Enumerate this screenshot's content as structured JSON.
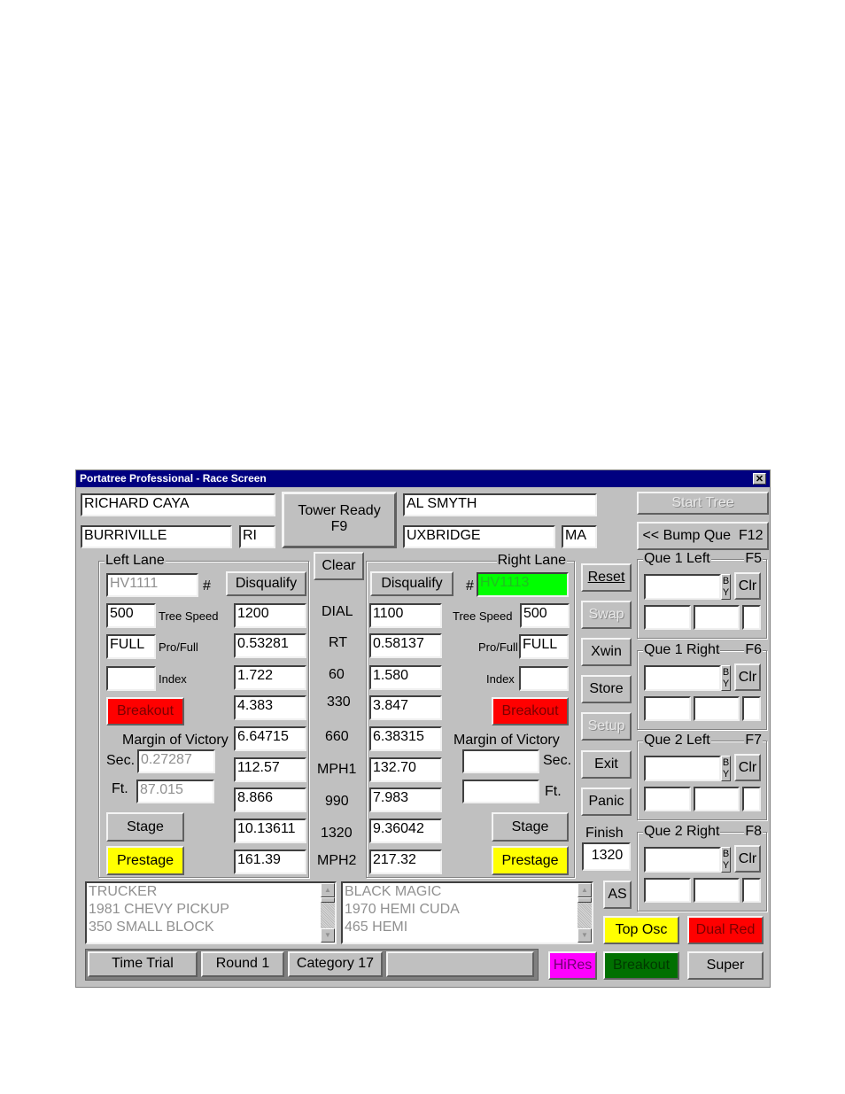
{
  "window": {
    "title": "Portatree Professional - Race Screen",
    "close_glyph": "✕"
  },
  "left": {
    "name": "RICHARD CAYA",
    "city": "BURRIVILLE",
    "state": "RI",
    "lane_label": "Left Lane",
    "car_number": "HV1111",
    "hash": "#",
    "disqualify": "Disqualify",
    "tree_speed_label": "Tree Speed",
    "tree_speed": "500",
    "pro_full_label": "Pro/Full",
    "pro_full": "FULL",
    "index_label": "Index",
    "index": "",
    "breakout": "Breakout",
    "margin_label": "Margin of Victory",
    "sec_label": "Sec.",
    "sec": "0.27287",
    "ft_label": "Ft.",
    "ft": "87.015",
    "stage": "Stage",
    "prestage": "Prestage",
    "times": {
      "dial": "1200",
      "rt": "0.53281",
      "t60": "1.722",
      "t330": "4.383",
      "t660": "6.64715",
      "mph1": "112.57",
      "t990": "8.866",
      "t1320": "10.13611",
      "mph2": "161.39"
    },
    "car_info": [
      "TRUCKER",
      "1981 CHEVY PICKUP",
      "350 SMALL BLOCK"
    ]
  },
  "right": {
    "name": "AL SMYTH",
    "city": "UXBRIDGE",
    "state": "MA",
    "lane_label": "Right Lane",
    "car_number": "HV1113",
    "hash": "#",
    "disqualify": "Disqualify",
    "tree_speed_label": "Tree Speed",
    "tree_speed": "500",
    "pro_full_label": "Pro/Full",
    "pro_full": "FULL",
    "index_label": "Index",
    "index": "",
    "breakout": "Breakout",
    "margin_label": "Margin of Victory",
    "sec_label": "Sec.",
    "sec": "",
    "ft_label": "Ft.",
    "ft": "",
    "stage": "Stage",
    "prestage": "Prestage",
    "times": {
      "dial": "1100",
      "rt": "0.58137",
      "t60": "1.580",
      "t330": "3.847",
      "t660": "6.38315",
      "mph1": "132.70",
      "t990": "7.983",
      "t1320": "9.36042",
      "mph2": "217.32"
    },
    "car_info": [
      "BLACK MAGIC",
      "1970 HEMI CUDA",
      "465 HEMI"
    ]
  },
  "center": {
    "tower_ready_line1": "Tower Ready",
    "tower_ready_line2": "F9",
    "clear": "Clear",
    "row_labels": {
      "dial": "DIAL",
      "rt": "RT",
      "t60": "60",
      "t330": "330",
      "t660": "660",
      "mph1": "MPH1",
      "t990": "990",
      "t1320": "1320",
      "mph2": "MPH2"
    }
  },
  "side_buttons": {
    "reset": "Reset",
    "swap": "Swap",
    "xwin": "Xwin",
    "store": "Store",
    "setup": "Setup",
    "exit": "Exit",
    "panic": "Panic",
    "finish_label": "Finish",
    "finish": "1320",
    "as": "AS"
  },
  "top_right": {
    "start_tree": "Start Tree",
    "bump_que": "<< Bump Que  F12"
  },
  "queues": [
    {
      "label": "Que 1 Left",
      "key": "F5",
      "by": "B Y",
      "clr": "Clr"
    },
    {
      "label": "Que 1 Right",
      "key": "F6",
      "by": "B Y",
      "clr": "Clr"
    },
    {
      "label": "Que 2 Left",
      "key": "F7",
      "by": "B Y",
      "clr": "Clr"
    },
    {
      "label": "Que 2 Right",
      "key": "F8",
      "by": "B Y",
      "clr": "Clr"
    }
  ],
  "mode_buttons": {
    "top_osc": "Top Osc",
    "dual_red": "Dual Red",
    "hires": "HiRes",
    "breakout": "Breakout",
    "super": "Super"
  },
  "status": {
    "type": "Time Trial",
    "round": "Round 1",
    "category": "Category 17",
    "extra": ""
  },
  "colors": {
    "title_bar": "#000080",
    "red": "#ff0000",
    "yellow": "#ffff00",
    "green_num": "#00ff00",
    "dark_green": "#007000",
    "magenta": "#ff00ff",
    "face": "#c0c0c0"
  }
}
